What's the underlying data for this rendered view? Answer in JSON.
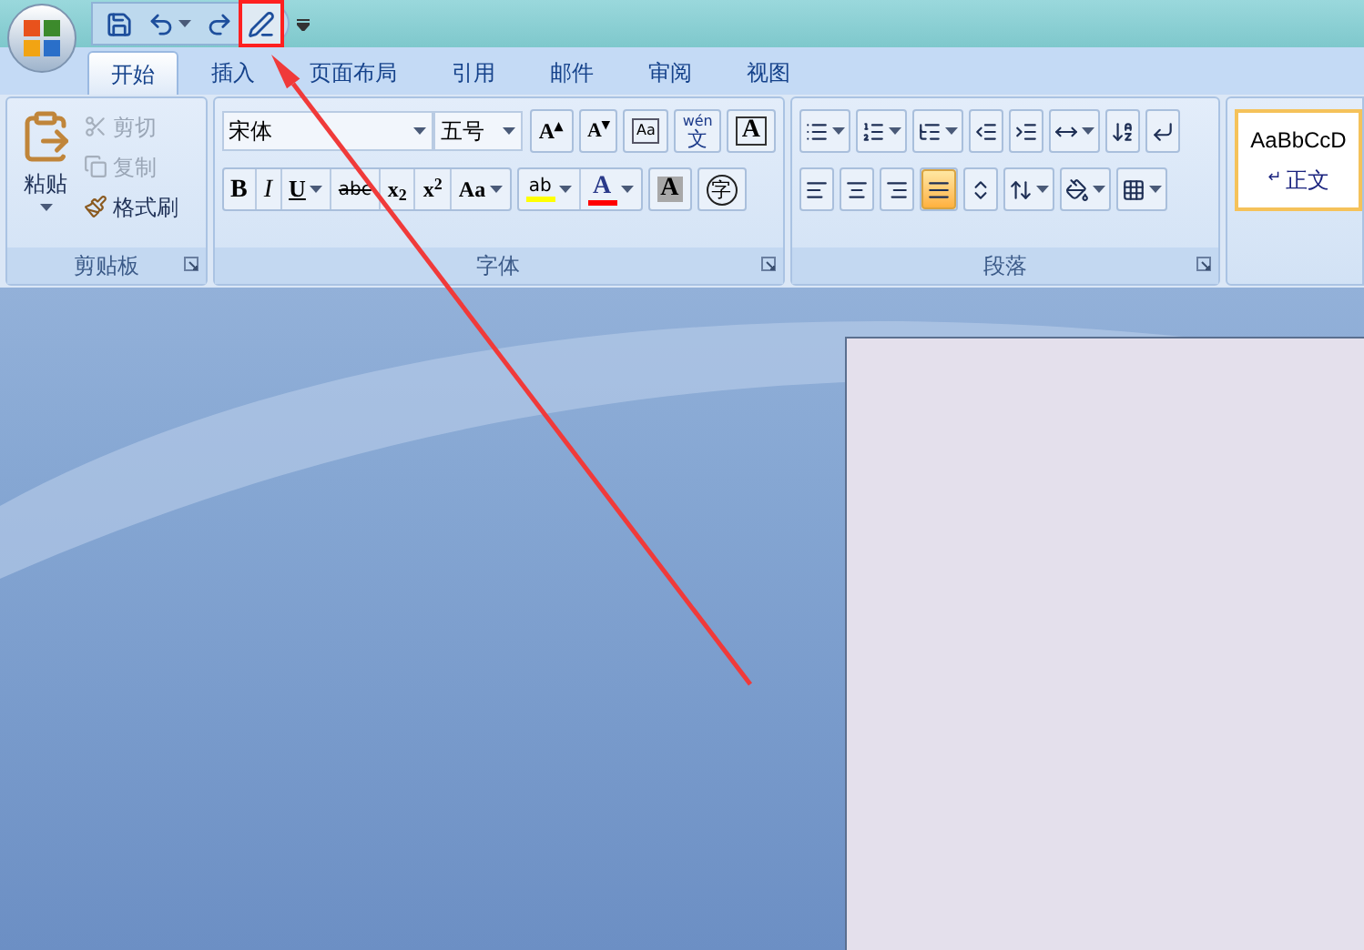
{
  "quick_access": [
    {
      "kind": "save",
      "highlighted": false,
      "dropdown": false
    },
    {
      "kind": "undo",
      "highlighted": false,
      "dropdown": true
    },
    {
      "kind": "redo",
      "highlighted": false,
      "dropdown": false
    },
    {
      "kind": "pen",
      "highlighted": true,
      "dropdown": false
    }
  ],
  "tabs": [
    {
      "label": "开始",
      "selected": true
    },
    {
      "label": "插入",
      "selected": false
    },
    {
      "label": "页面布局",
      "selected": false
    },
    {
      "label": "引用",
      "selected": false
    },
    {
      "label": "邮件",
      "selected": false
    },
    {
      "label": "审阅",
      "selected": false
    },
    {
      "label": "视图",
      "selected": false
    }
  ],
  "clipboard": {
    "title": "剪贴板",
    "paste": "粘贴",
    "items": [
      {
        "kind": "cut",
        "label": "剪切",
        "disabled": true
      },
      {
        "kind": "copy",
        "label": "复制",
        "disabled": true
      },
      {
        "kind": "painter",
        "label": "格式刷",
        "disabled": false
      }
    ]
  },
  "font": {
    "title": "字体",
    "font_name": "宋体",
    "font_size": "五号",
    "row_1": [
      {
        "glyph": "A$^{▴}$",
        "kind": "text"
      },
      {
        "glyph": "A$^{▾}$",
        "kind": "small"
      },
      {
        "glyph": "Aa",
        "kind": "eraser"
      },
      {
        "glyph": "wén",
        "kind": "phonetic",
        "sub": "文"
      },
      {
        "glyph": "A",
        "kind": "boxed"
      }
    ],
    "row_2": [
      {
        "glyph": "B",
        "kind": "bold",
        "dropdown": false
      },
      {
        "glyph": "I",
        "kind": "italic",
        "dropdown": false
      },
      {
        "glyph": "U",
        "kind": "underline",
        "dropdown": true
      },
      {
        "glyph": "abc",
        "kind": "strike",
        "dropdown": false
      },
      {
        "glyph": "x$_{2}$",
        "kind": "text",
        "dropdown": false
      },
      {
        "glyph": "x$^{2}$",
        "kind": "text",
        "dropdown": false
      },
      {
        "glyph": "Aa",
        "kind": "text",
        "dropdown": true
      },
      {
        "glyph": "ab",
        "kind": "highlight",
        "dropdown": true,
        "color": "#ffff00"
      },
      {
        "glyph": "A",
        "kind": "fontcolor",
        "dropdown": true,
        "color": "#ff0000"
      },
      {
        "glyph": "A",
        "kind": "shaded",
        "dropdown": false
      },
      {
        "glyph": "字",
        "kind": "circled",
        "dropdown": false
      }
    ]
  },
  "paragraph": {
    "title": "段落",
    "row_1": [
      {
        "kind": "bullets",
        "dropdown": true,
        "selected": false
      },
      {
        "kind": "numbering",
        "dropdown": true,
        "selected": false
      },
      {
        "kind": "multilevel",
        "dropdown": true,
        "selected": false
      },
      {
        "kind": "outdent",
        "dropdown": false,
        "selected": false
      },
      {
        "kind": "indent",
        "dropdown": false,
        "selected": false
      },
      {
        "kind": "layout",
        "dropdown": true,
        "selected": false
      },
      {
        "kind": "sort",
        "dropdown": false,
        "selected": false
      },
      {
        "kind": "marks",
        "dropdown": false,
        "selected": false
      }
    ],
    "row_2": [
      {
        "kind": "left",
        "dropdown": false,
        "selected": false
      },
      {
        "kind": "center",
        "dropdown": false,
        "selected": false
      },
      {
        "kind": "right",
        "dropdown": false,
        "selected": false
      },
      {
        "kind": "justify",
        "dropdown": false,
        "selected": true
      },
      {
        "kind": "distribute",
        "dropdown": false,
        "selected": false
      },
      {
        "kind": "spacing",
        "dropdown": true,
        "selected": false
      },
      {
        "kind": "shading",
        "dropdown": true,
        "selected": false
      },
      {
        "kind": "borders",
        "dropdown": true,
        "selected": false
      }
    ]
  },
  "styles": {
    "preview": "AaBbCcD",
    "mark": "↵",
    "name": "正文"
  }
}
